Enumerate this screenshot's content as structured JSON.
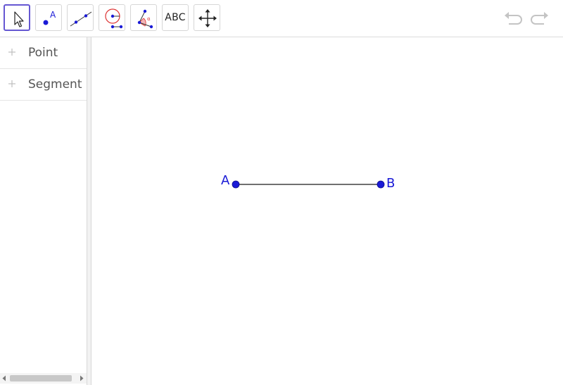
{
  "toolbar": {
    "tools": [
      {
        "name": "Move",
        "icon": "cursor-arrow-icon"
      },
      {
        "name": "Point",
        "icon": "point-icon",
        "glyph_label": "A"
      },
      {
        "name": "Segment",
        "icon": "segment-icon"
      },
      {
        "name": "Circle with Center through Point",
        "icon": "circle-center-icon"
      },
      {
        "name": "Angle",
        "icon": "angle-icon"
      },
      {
        "name": "Text",
        "icon": "text-icon",
        "label": "ABC"
      },
      {
        "name": "Move Graphics View",
        "icon": "move-graphics-icon"
      }
    ],
    "active_tool": "Move",
    "undo_icon": "undo-icon",
    "redo_icon": "redo-icon"
  },
  "algebra": {
    "items": [
      {
        "label": "Point"
      },
      {
        "label": "Segment"
      }
    ]
  },
  "graphics": {
    "points": [
      {
        "label": "A"
      },
      {
        "label": "B"
      }
    ],
    "segment": {
      "from": "A",
      "to": "B"
    }
  },
  "colors": {
    "point": "#1a1ad6",
    "active_tool_border": "#6557d2",
    "segment": "#1a1a1a",
    "label_text": "#555555"
  }
}
